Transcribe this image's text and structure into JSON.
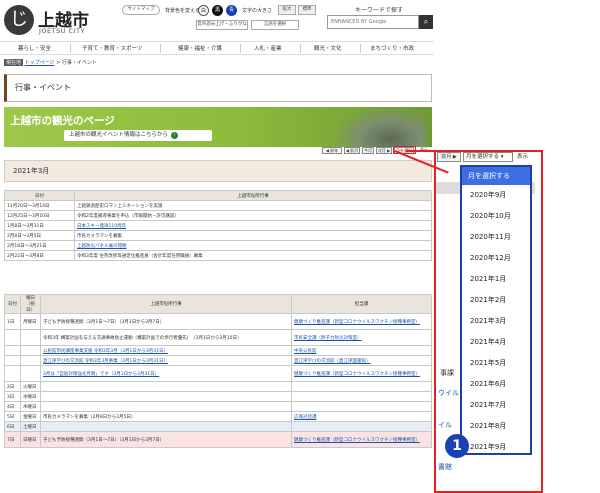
{
  "header": {
    "logo_mark": "じ",
    "title": "上越市",
    "subtitle": "JOETSU CITY",
    "sitemap": "サイトマップ",
    "bg_label": "背景色を変える",
    "bg_white": "白",
    "bg_black": "黒",
    "bg_blue": "青",
    "font_label": "文字の大きさ",
    "font_large": "拡大",
    "font_std": "標準",
    "voice": "音声読み上げ・ふりがな",
    "lang": "言語を選択",
    "search_label": "キーワードで探す",
    "search_placeholder": "ENHANCED BY Google",
    "search_icon": "search-icon"
  },
  "nav": [
    "暮らし・安全",
    "子育て・教育・スポーツ",
    "健康・福祉・介護",
    "入札・産業",
    "観光・文化",
    "まちづくり・市政"
  ],
  "breadcrumb": {
    "here": "現在地",
    "top": "トップページ",
    "sep": " > ",
    "current": "行事・イベント"
  },
  "page_title": "行事・イベント",
  "banner": {
    "title": "上越市の観光のページ",
    "sub": "上越市の観光イベント情報はこちらから",
    "arrow": "›"
  },
  "mini_nav": {
    "prev_year": "◀ 前年",
    "prev_month": "◀ 前月",
    "this_month": "今月",
    "next_month": "次月 ▶",
    "select": "月を選択",
    "show": "表示"
  },
  "month_title": "2021年3月",
  "table1": {
    "headers": [
      "日付",
      "上越市役所行事"
    ],
    "rows": [
      [
        "11月20日～3月14日",
        "上越鉄道歴史ロマン上ミネーションを実施"
      ],
      [
        "12月25日～3月10日",
        "令和2年度補導事業を申込（市報開始・許可講談）"
      ],
      [
        "1月8日～3月31日",
        "日本スキー発祥110周年"
      ],
      [
        "2月8日～3月5日",
        "市民カメラマンを募集"
      ],
      [
        "2月18日～3月21日",
        "上越防災パネル展の開催"
      ],
      [
        "2月22日～3月8日",
        "令和3年度 住宅改修等通定化推進員（会計年度任用職員）募集"
      ]
    ]
  },
  "table2": {
    "headers": [
      "日付",
      "曜日（祝日）",
      "上越市役所行事",
      "担当課"
    ],
    "rows": [
      [
        "1日",
        "月曜日",
        "子ども予防接種週間（3月1日～7日）（3月1日から3月7日）",
        "健康づくり推進課（新型コロナウイルスワクチン接種事務室）",
        ""
      ],
      [
        "",
        "",
        "令和3年 構築計画を与える交通事故防止運動（構築計画での歩行者優先）　（3月1日から3月10日）",
        "市民安全課（原子力防災対策室）",
        ""
      ],
      [
        "",
        "",
        "公民館市民講座事業支援 令和3年3月（3月1日から3月31日）",
        "中央公民館",
        ""
      ],
      [
        "",
        "",
        "直江津学びの交流館 令和3年3月事業（3月1日から3月31日）",
        "直江津学びの交流館（直江津図書館）",
        ""
      ],
      [
        "",
        "",
        "3月は「自殺対策強化月間」です（3月1日から3月31日）",
        "健康づくり推進課（新型コロナウイルスワクチン接種事務室）",
        ""
      ],
      [
        "2日",
        "火曜日",
        "",
        "",
        ""
      ],
      [
        "3日",
        "水曜日",
        "",
        "",
        ""
      ],
      [
        "4日",
        "木曜日",
        "",
        "",
        ""
      ],
      [
        "5日",
        "金曜日",
        "市民カメラマンを募集（2月8日から3月5日）",
        "広報対話課",
        ""
      ],
      [
        "6日",
        "土曜日",
        "",
        "",
        "sat"
      ],
      [
        "7日",
        "日曜日",
        "子ども予防接種週間（3月1日～7日）（3月1日から3月7日）",
        "健康づくり推進課（新型コロナウイルスワクチン接種事務室）",
        "sun"
      ]
    ]
  },
  "side": {
    "text1": "ウイル",
    "text2": "事課",
    "text3": "イル",
    "text4": "書館"
  },
  "popup": {
    "prev": "前月 ▶",
    "select": "月を選択する ▾",
    "show": "表示",
    "header": "月を選択する",
    "options": [
      "2020年9月",
      "2020年10月",
      "2020年11月",
      "2020年12月",
      "2021年1月",
      "2021年2月",
      "2021年3月",
      "2021年4月",
      "2021年5月",
      "2021年6月",
      "2021年7月",
      "2021年8月",
      "2021年9月"
    ]
  },
  "badge": "1",
  "colors": {
    "accent_red": "#e52222",
    "dropdown_blue": "#1c3fb0",
    "banner_green": "#8cbb3c"
  }
}
